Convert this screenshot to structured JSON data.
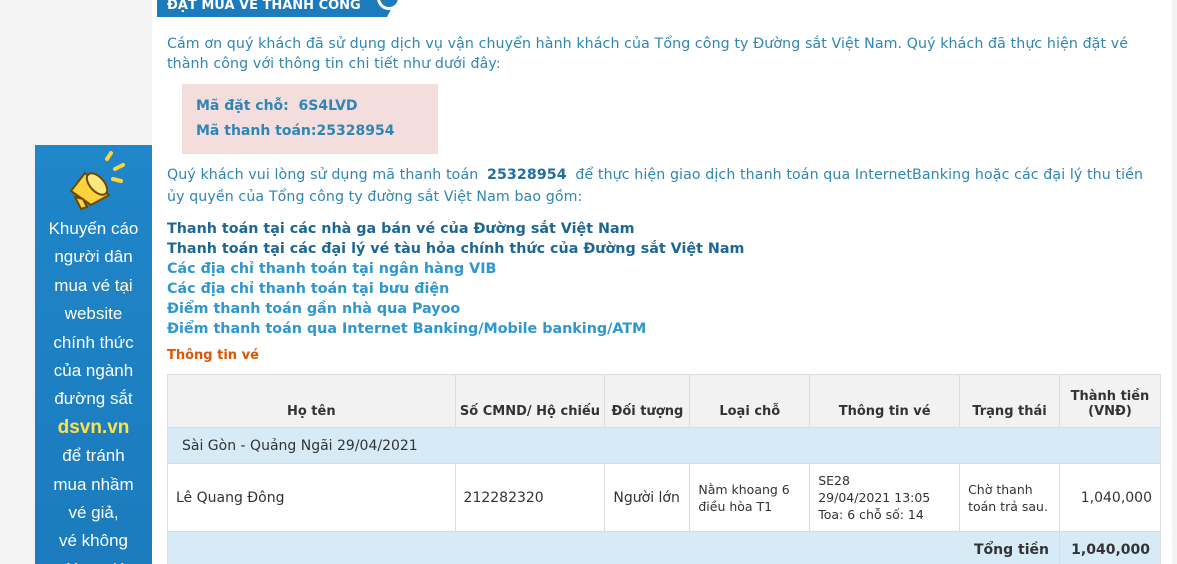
{
  "header": {
    "title": "ĐẶT MUA VÉ THÀNH CÔNG"
  },
  "intro": "Cám ơn quý khách đã sử dụng dịch vụ vận chuyển hành khách của Tổng công ty Đường sắt Việt Nam. Quý khách đã thực hiện đặt vé thành công với thông tin chi tiết như dưới đây:",
  "booking": {
    "reservation_label": "Mã đặt chỗ:",
    "reservation_code": "6S4LVD",
    "payment_label": "Mã thanh toán:",
    "payment_code": "25328954"
  },
  "payment_notice": {
    "before": "Quý khách vui lòng sử dụng mã thanh toán",
    "code": "25328954",
    "after": "để thực hiện giao dịch thanh toán qua InternetBanking hoặc các đại lý thu tiền ủy quyền của Tổng công ty đường sắt Việt Nam bao gồm:"
  },
  "payment_links": [
    "Thanh toán tại các nhà ga bán vé của Đường sắt Việt Nam",
    "Thanh toán tại các đại lý vé tàu hỏa chính thức của Đường sắt Việt Nam",
    "Các địa chỉ thanh toán tại ngân hàng VIB",
    "Các địa chỉ thanh toán tại bưu điện",
    "Điểm thanh toán gần nhà qua Payoo",
    "Điểm thanh toán qua Internet Banking/Mobile banking/ATM"
  ],
  "ticket_section_title": "Thông tin vé",
  "table": {
    "headers": [
      "Họ tên",
      "Số CMND/ Hộ chiếu",
      "Đối tượng",
      "Loại chỗ",
      "Thông tin vé",
      "Trạng thái",
      "Thành tiền (VNĐ)"
    ],
    "route": "Sài Gòn - Quảng Ngãi 29/04/2021",
    "row": {
      "name": "Lê Quang Đông",
      "id_number": "212282320",
      "passenger_type": "Người lớn",
      "seat_type": "Nằm khoang 6 điều hòa T1",
      "ticket_info_line1": "SE28",
      "ticket_info_line2": "29/04/2021 13:05",
      "ticket_info_line3": "Toa: 6 chỗ số: 14",
      "status": "Chờ thanh toán trả sau.",
      "amount": "1,040,000"
    },
    "total_label": "Tổng tiền",
    "total_amount": "1,040,000"
  },
  "banner": {
    "lines": [
      "Khuyến cáo",
      "người dân",
      "mua vé tại",
      "website",
      "chính thức",
      "của ngành",
      "đường sắt"
    ],
    "brand": "dsvn.vn",
    "lines2": [
      "để tránh",
      "mua nhầm",
      "vé giả,",
      "vé không",
      "đúng giá"
    ]
  },
  "colors": {
    "primary": "#1b7bbd",
    "text": "#2e86b5",
    "highlight": "#f4dddd",
    "accent": "#e05500"
  }
}
